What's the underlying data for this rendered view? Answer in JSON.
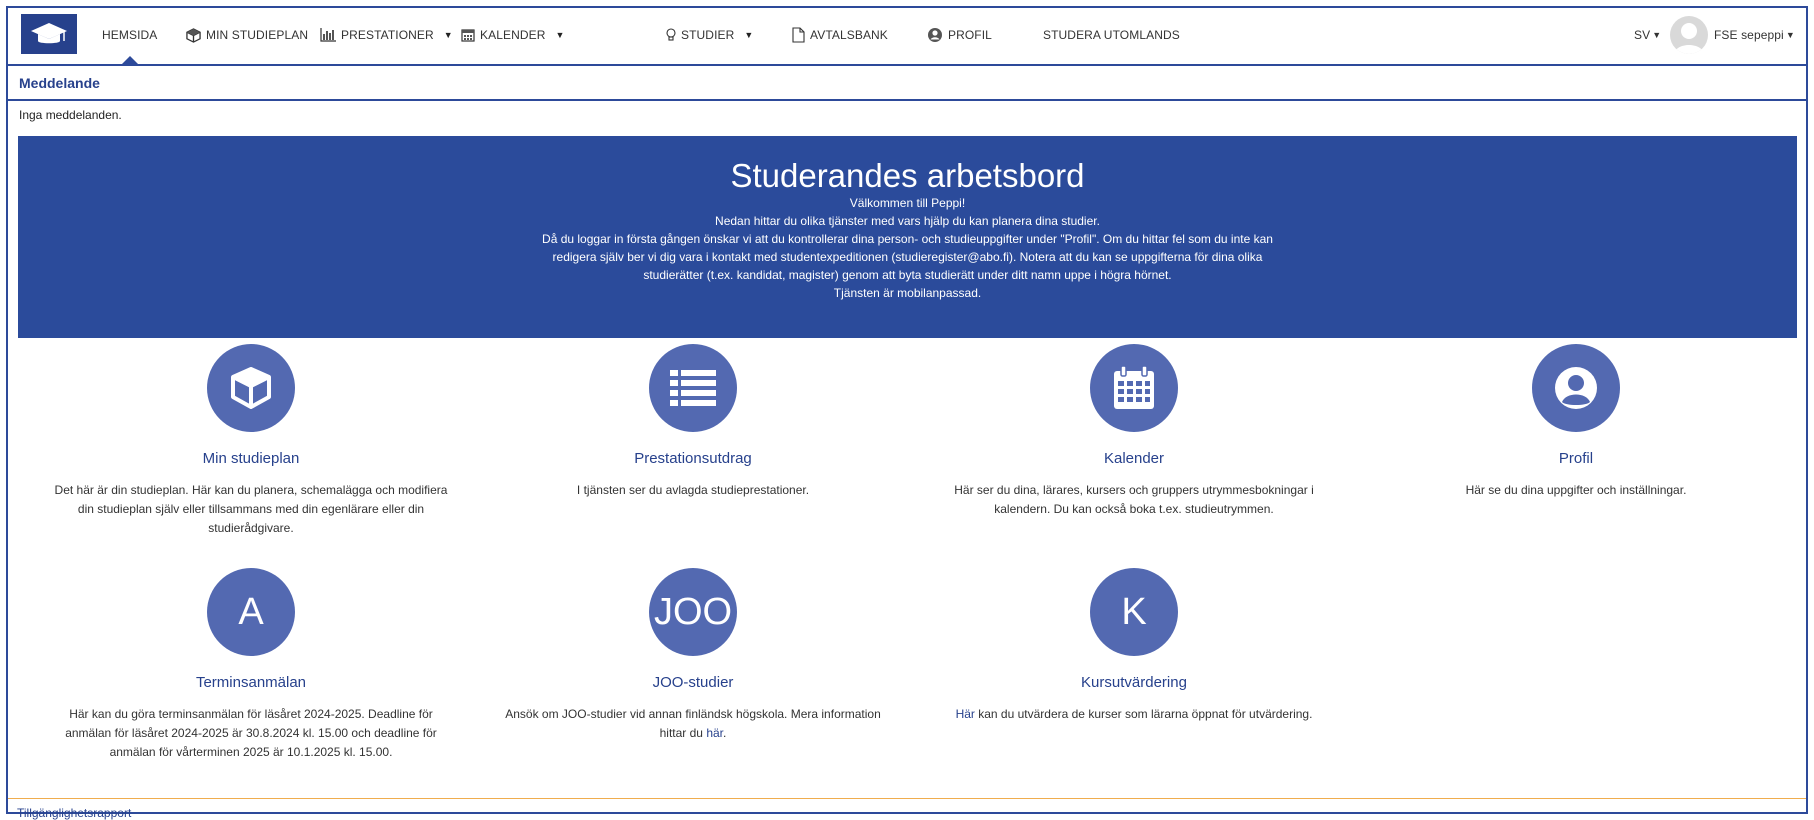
{
  "nav": {
    "items": [
      {
        "label": "HEMSIDA"
      },
      {
        "label": "MIN STUDIEPLAN"
      },
      {
        "label": "PRESTATIONER"
      },
      {
        "label": "KALENDER"
      },
      {
        "label": "STUDIER"
      },
      {
        "label": "AVTALSBANK"
      },
      {
        "label": "PROFIL"
      },
      {
        "label": "STUDERA UTOMLANDS"
      }
    ],
    "language": "SV",
    "user": "FSE sepeppi"
  },
  "message": {
    "heading": "Meddelande",
    "body": "Inga meddelanden."
  },
  "hero": {
    "title": "Studerandes arbetsbord",
    "lines": [
      "Välkommen till Peppi!",
      "Nedan hittar du olika tjänster med vars hjälp du kan planera dina studier.",
      "Då du loggar in första gången önskar vi att du kontrollerar dina person- och studieuppgifter under \"Profil\". Om du hittar fel som du inte kan",
      "redigera själv ber vi dig vara i kontakt med studentexpeditionen (studieregister@abo.fi). Notera att du kan se uppgifterna för dina olika",
      "studierätter (t.ex. kandidat, magister) genom att byta studierätt under ditt namn uppe i högra hörnet.",
      "Tjänsten är mobilanpassad."
    ]
  },
  "cards": [
    {
      "icon": "cube-icon",
      "title": "Min studieplan",
      "desc": "Det här är din studieplan. Här kan du planera, schemalägga och modifiera din studieplan själv eller tillsammans med din egenlärare eller din studierådgivare."
    },
    {
      "icon": "list-icon",
      "title": "Prestationsutdrag",
      "desc": "I tjänsten ser du avlagda studieprestationer."
    },
    {
      "icon": "calendar-icon",
      "title": "Kalender",
      "desc": "Här ser du dina, lärares, kursers och gruppers utrymmesbokningar i kalendern. Du kan också boka t.ex. studieutrymmen."
    },
    {
      "icon": "user-circle-icon",
      "title": "Profil",
      "desc": "Här se du dina uppgifter och inställningar."
    },
    {
      "icon_text": "A",
      "title": "Terminsanmälan",
      "desc": "Här kan du göra terminsanmälan för läsåret 2024-2025. Deadline för anmälan för läsåret 2024-2025 är 30.8.2024 kl. 15.00 och deadline för anmälan för vårterminen 2025 är 10.1.2025 kl. 15.00."
    },
    {
      "icon_text": "JOO",
      "title": "JOO-studier",
      "desc_prefix": "Ansök om JOO-studier vid annan finländsk högskola. Mera information hittar du ",
      "desc_link": "här",
      "desc_suffix": "."
    },
    {
      "icon_text": "K",
      "title": "Kursutvärdering",
      "desc_link": "Här",
      "desc_suffix": " kan du utvärdera de kurser som lärarna öppnat för utvärdering."
    }
  ],
  "footer": {
    "link": "Tillgänglighetsrapport"
  },
  "colors": {
    "brand": "#27418c",
    "hero_bg": "#2b4b9b",
    "circle": "#5369b1",
    "footer_line": "#f0ad4e"
  }
}
